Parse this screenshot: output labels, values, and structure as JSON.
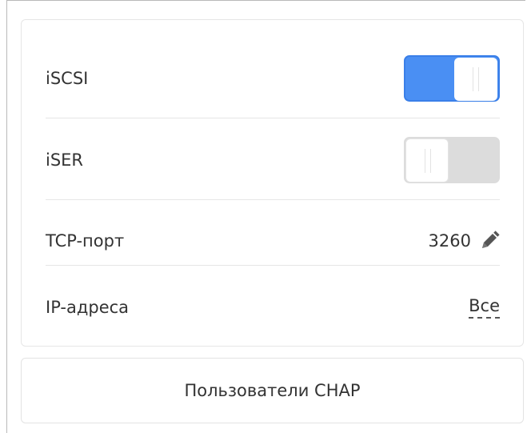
{
  "settings": {
    "iscsi": {
      "label": "iSCSI",
      "enabled": true
    },
    "iser": {
      "label": "iSER",
      "enabled": false
    },
    "tcp_port": {
      "label": "TCP-порт",
      "value": "3260",
      "edit_icon": "pencil-icon"
    },
    "ip_addresses": {
      "label": "IP-адреса",
      "value": "Все"
    }
  },
  "chap_button": {
    "label": "Пользователи CHAP"
  },
  "colors": {
    "toggle_on": "#4a8ff3",
    "toggle_off": "#dcdcdc",
    "text": "#333333",
    "divider": "#e6e6e6"
  }
}
